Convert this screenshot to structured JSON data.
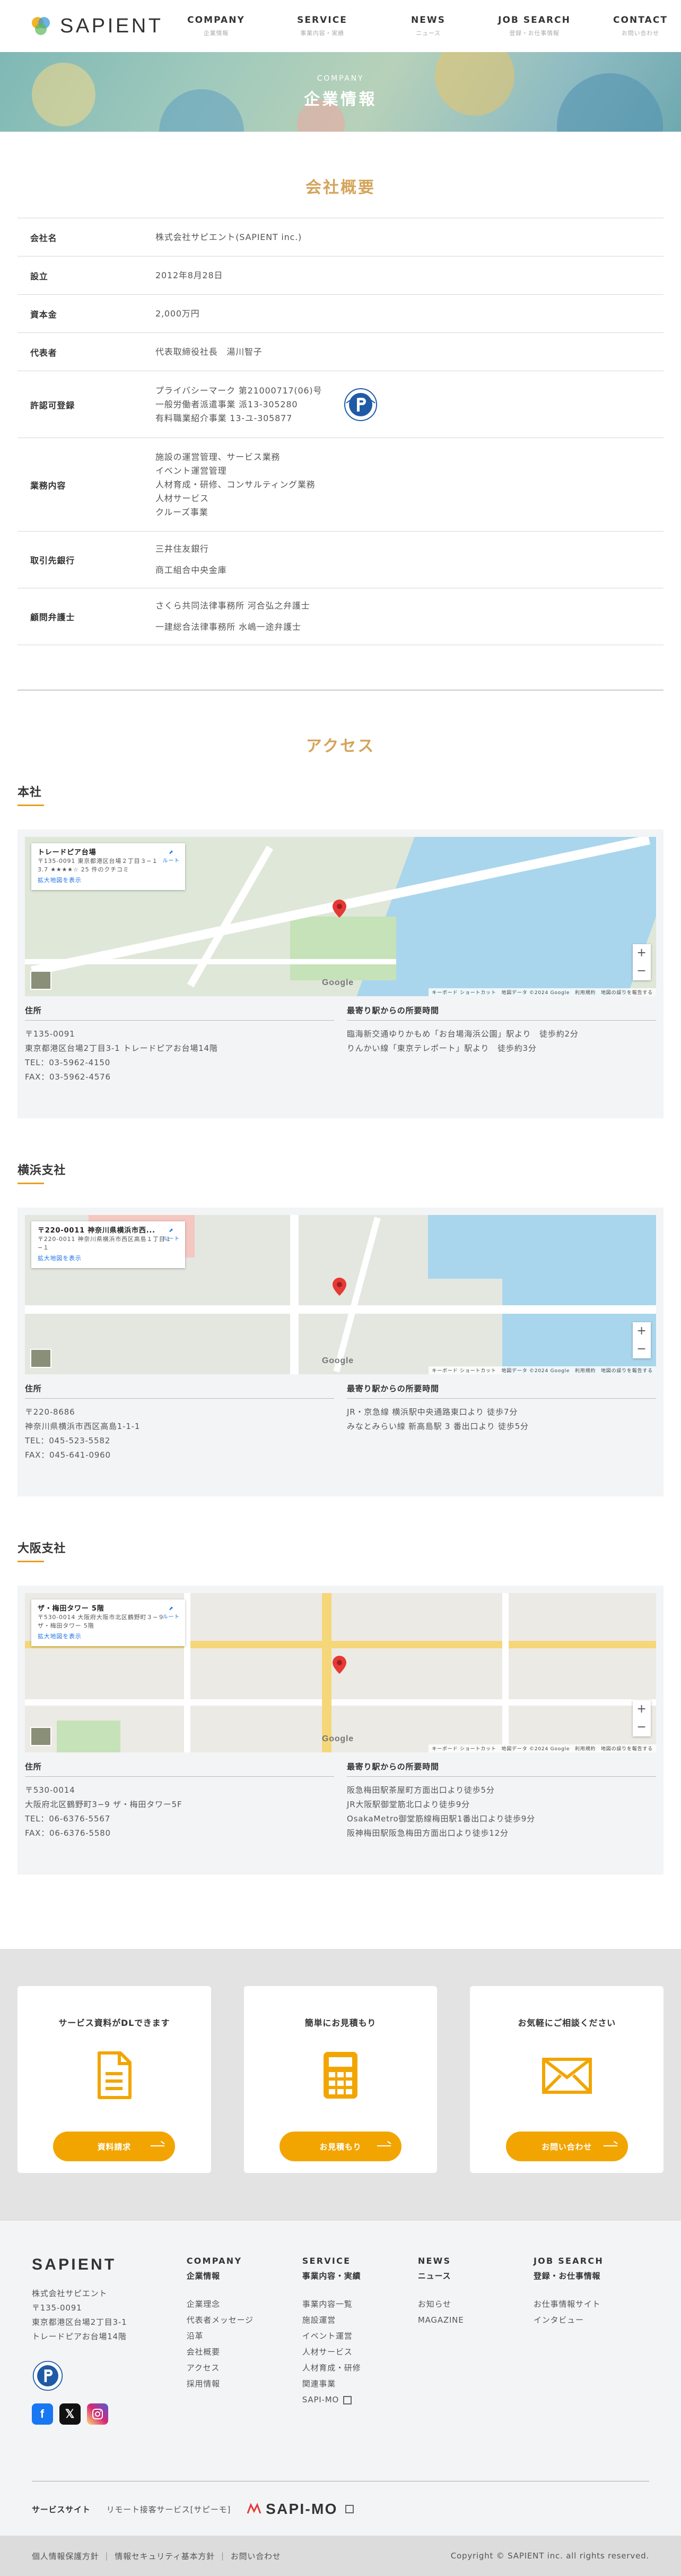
{
  "header": {
    "logo": "SAPIENT",
    "nav": [
      {
        "en": "COMPANY",
        "jp": "企業情報"
      },
      {
        "en": "SERVICE",
        "jp": "事業内容・実績"
      },
      {
        "en": "NEWS",
        "jp": "ニュース"
      },
      {
        "en": "JOB SEARCH",
        "jp": "登録・お仕事情報"
      },
      {
        "en": "CONTACT",
        "jp": "お問い合わせ"
      }
    ]
  },
  "hero": {
    "en": "COMPANY",
    "title": "企業情報"
  },
  "overview": {
    "title": "会社概要",
    "rows": [
      {
        "key": "会社名",
        "lines": [
          "株式会社サピエント(SAPIENT inc.)"
        ]
      },
      {
        "key": "設立",
        "lines": [
          "2012年8月28日"
        ]
      },
      {
        "key": "資本金",
        "lines": [
          "2,000万円"
        ]
      },
      {
        "key": "代表者",
        "lines": [
          "代表取締役社長　湯川智子"
        ]
      },
      {
        "key": "許認可登録",
        "lines": [
          "プライバシーマーク 第21000717(06)号",
          "一般労働者派遣事業 派13-305280",
          "有料職業紹介事業 13-ユ-305877"
        ]
      },
      {
        "key": "業務内容",
        "lines": [
          "施設の運営管理、サービス業務",
          "イベント運営管理",
          "人材育成・研修、コンサルティング業務",
          "人材サービス",
          "クルーズ事業"
        ]
      },
      {
        "key": "取引先銀行",
        "lines": [
          "三井住友銀行",
          "商工組合中央金庫"
        ]
      },
      {
        "key": "顧問弁護士",
        "lines": [
          "さくら共同法律事務所 河合弘之弁護士",
          "一建総合法律事務所 水嶋一途弁護士"
        ]
      }
    ]
  },
  "access": {
    "title": "アクセス",
    "address_label": "住所",
    "station_label": "最寄り駅からの所要時間",
    "zoom_in": "+",
    "zoom_out": "−",
    "map_link": "拡大地図を表示",
    "directions": "ルート",
    "map_attribution": "キーボード ショートカット　地図データ ©2024 Google　利用規約　地図の誤りを報告する",
    "google": "Google",
    "branches": [
      {
        "name": "本社",
        "map_place": "トレードピア台場",
        "map_address": "〒135-0091 東京都港区台場２丁目３−１",
        "map_rating": "3.7 ★★★★☆ 25 件のクチコミ",
        "address": [
          "〒135-0091",
          "東京都港区台場2丁目3-1 トレードピアお台場14階",
          "TEL：03-5962-4150",
          "FAX：03-5962-4576"
        ],
        "station": [
          "臨海新交通ゆりかもめ「お台場海浜公園」駅より　徒歩約2分",
          "りんかい線「東京テレポート」駅より　徒歩約3分"
        ]
      },
      {
        "name": "横浜支社",
        "map_place": "〒220-0011 神奈川県横浜市西...",
        "map_address": "〒220-0011 神奈川県横浜市西区高島１丁目１−１",
        "map_rating": "",
        "address": [
          "〒220-8686",
          "神奈川県横浜市西区高島1-1-1",
          "TEL：045-523-5582",
          "FAX：045-641-0960"
        ],
        "station": [
          "JR・京急線 横浜駅中央通路東口より 徒歩7分",
          "みなとみらい線 新高島駅 3 番出口より 徒歩5分"
        ]
      },
      {
        "name": "大阪支社",
        "map_place": "ザ・梅田タワー 5階",
        "map_address": "〒530-0014 大阪府大阪市北区鶴野町３−９ ザ・梅田タワー 5階",
        "map_rating": "",
        "address": [
          "〒530-0014",
          "大阪府北区鶴野町3−9 ザ・梅田タワー5F",
          "TEL：06-6376-5567",
          "FAX：06-6376-5580"
        ],
        "station": [
          "阪急梅田駅茶屋町方面出口より徒歩5分",
          "JR大阪駅御堂筋北口より徒歩9分",
          "OsakaMetro御堂筋線梅田駅1番出口より徒歩9分",
          "阪神梅田駅阪急梅田方面出口より徒歩12分"
        ]
      }
    ]
  },
  "cta": [
    {
      "title": "サービス資料がDLできます",
      "button": "資料請求",
      "icon": "document-icon"
    },
    {
      "title": "簡単にお見積もり",
      "button": "お見積もり",
      "icon": "calculator-icon"
    },
    {
      "title": "お気軽にご相談ください",
      "button": "お問い合わせ",
      "icon": "envelope-icon"
    }
  ],
  "footer": {
    "logo": "SAPIENT",
    "company_lines": [
      "株式会社サピエント",
      "〒135-0091",
      "東京都港区台場2丁目3-1",
      "トレードピアお台場14階"
    ],
    "columns": [
      {
        "en": "COMPANY",
        "jp": "企業情報",
        "items": [
          "企業理念",
          "代表者メッセージ",
          "沿革",
          "会社概要",
          "アクセス",
          "採用情報"
        ]
      },
      {
        "en": "SERVICE",
        "jp": "事業内容・実績",
        "items": [
          "事業内容一覧",
          "施設運営",
          "イベント運営",
          "人材サービス",
          "人材育成・研修",
          "関連事業",
          "SAPI-MO"
        ]
      },
      {
        "en": "NEWS",
        "jp": "ニュース",
        "items": [
          "お知らせ",
          "MAGAZINE"
        ]
      },
      {
        "en": "JOB SEARCH",
        "jp": "登録・お仕事情報",
        "items": [
          "お仕事情報サイト",
          "インタビュー"
        ]
      }
    ],
    "sites_label": "サービスサイト",
    "sites_text": "リモート接客サービス[サピーモ]",
    "sapimo": "SAPI-MO",
    "bottom_links": [
      "個人情報保護方針",
      "情報セキュリティ基本方針",
      "お問い合わせ"
    ],
    "copyright": "Copyright © SAPIENT inc. all rights reserved.",
    "colors": {
      "accent": "#f2a500",
      "gold": "#d4a35a",
      "facebook": "#1877f2",
      "x": "#111111",
      "instagram": "#d62976"
    }
  }
}
